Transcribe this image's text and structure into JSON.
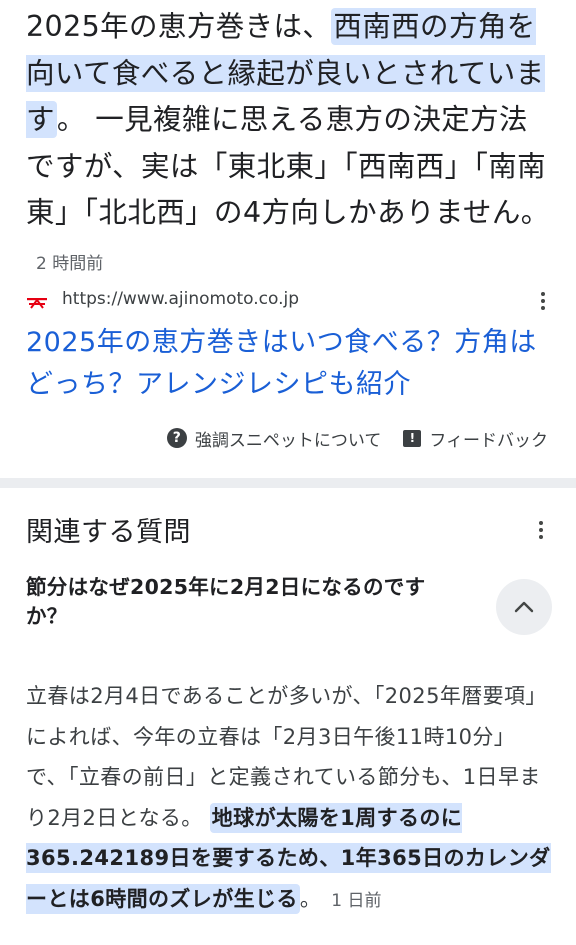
{
  "featured_snippet": {
    "lead": "2025年の恵方巻きは、",
    "highlight": "西南西の方角を向いて食べると縁起が良いとされています",
    "highlight_end": "。",
    "rest": "一見複雑に思える恵方の決定方法ですが、実は「東北東」「西南西」「南南東」「北北西」の4方向しかありません。",
    "age": "2 時間前"
  },
  "source": {
    "url": "https://www.ajinomoto.co.jp",
    "title": "2025年の恵方巻きはいつ食べる？方角はどっち？アレンジレシピも紹介"
  },
  "footer": {
    "about_label": "強調スニペットについて",
    "feedback_label": "フィードバック"
  },
  "related": {
    "title": "関連する質問",
    "question": "節分はなぜ2025年に2月2日になるのですか？",
    "answer_plain": "立春は2月4日であることが多いが、「2025年暦要項」によれば、今年の立春は「2月3日午後11時10分」で、「立春の前日」と定義されている節分も、1日早まり2月2日となる。",
    "answer_highlight": "地球が太陽を1周するのに365.242189日を要するため、1年365日のカレンダーとは6時間のズレが生じる",
    "answer_end": "。",
    "age": "1 日前"
  },
  "icons": {
    "favicon": "ajinomoto-logo-icon",
    "more": "more-vert-icon",
    "help": "help-circle-icon",
    "feedback": "feedback-icon",
    "collapse": "chevron-up-icon"
  },
  "colors": {
    "highlight": "#d3e3fd",
    "link": "#1a5fd6",
    "separator": "#ebedf0",
    "brand_red": "#e60012"
  }
}
